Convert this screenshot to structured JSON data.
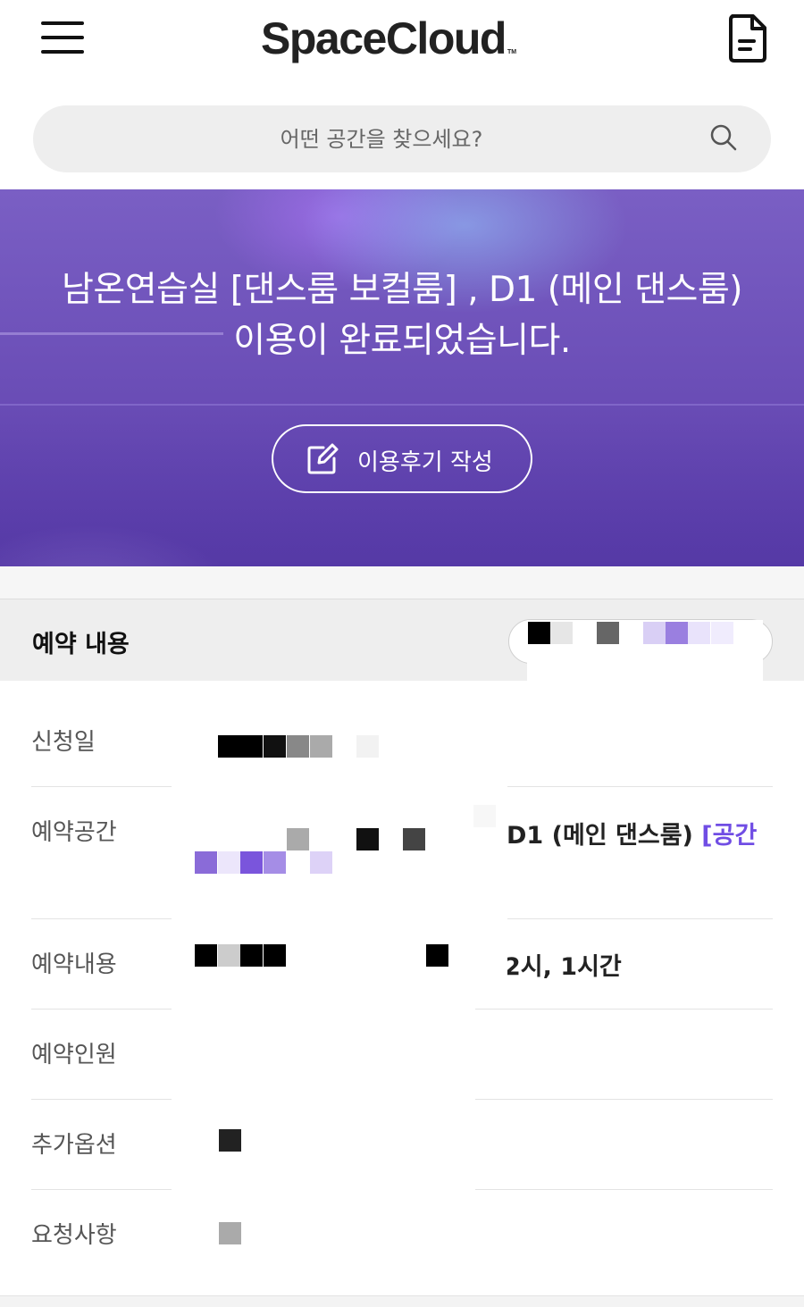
{
  "header": {
    "logo_text": "SpaceCloud",
    "logo_tm": "TM"
  },
  "search": {
    "placeholder": "어떤 공간을 찾으세요?"
  },
  "hero": {
    "title_line1": "남온연습실 [댄스룸 보컬룸] , D1 (메인 댄스룸)",
    "title_line2": "이용이 완료되었습니다.",
    "review_button_label": "이용후기 작성"
  },
  "reservation": {
    "section_title": "예약 내용",
    "rows": [
      {
        "key": "신청일",
        "value": ""
      },
      {
        "key": "예약공간",
        "value": "D1 (메인 댄스룸) ",
        "link": "[공간"
      },
      {
        "key": "예약내용",
        "value": "2시,  1시간"
      },
      {
        "key": "예약인원",
        "value": ""
      },
      {
        "key": "추가옵션",
        "value": ""
      },
      {
        "key": "요청사항",
        "value": ""
      }
    ]
  },
  "colors": {
    "accent": "#704de4",
    "hero_overlay": "#6a4db6"
  },
  "icons": {
    "menu": "hamburger-menu-icon",
    "document": "document-icon",
    "search": "search-icon",
    "review": "edit-icon"
  }
}
